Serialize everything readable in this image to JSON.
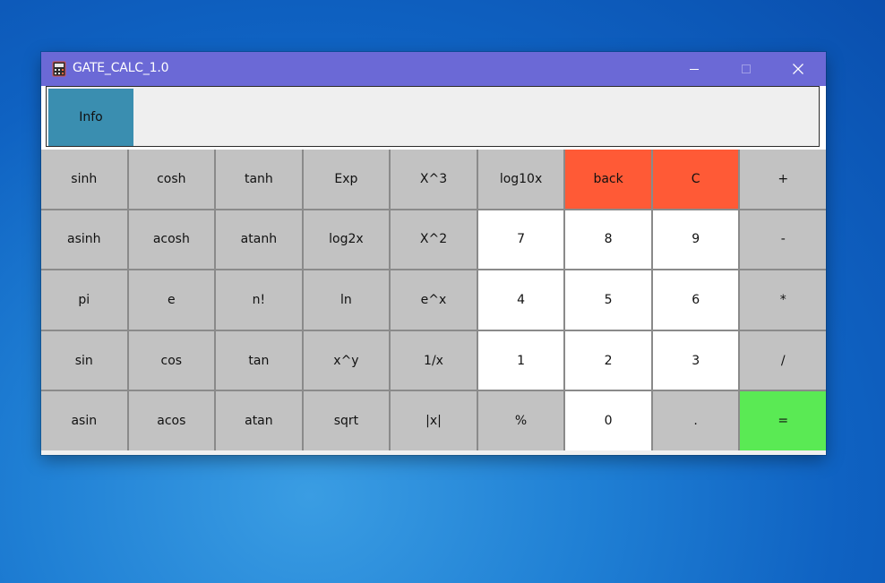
{
  "window": {
    "title": "GATE_CALC_1.0",
    "icon": "calculator-icon",
    "controls": [
      "minimize-icon",
      "maximize-icon",
      "close-icon"
    ]
  },
  "info_button": {
    "label": "Info"
  },
  "display": {
    "value": ""
  },
  "colors": {
    "titlebar": "#6b69d6",
    "info": "#3a8eb0",
    "function_key": "#c2c2c2",
    "digit_key": "#ffffff",
    "clear_key": "#ff5a36",
    "equals_key": "#5aea54"
  },
  "keys": [
    {
      "label": "sinh"
    },
    {
      "label": "cosh"
    },
    {
      "label": "tanh"
    },
    {
      "label": "Exp"
    },
    {
      "label": "X^3"
    },
    {
      "label": "log10x"
    },
    {
      "label": "back"
    },
    {
      "label": "C"
    },
    {
      "label": "+"
    },
    {
      "label": "asinh"
    },
    {
      "label": "acosh"
    },
    {
      "label": "atanh"
    },
    {
      "label": "log2x"
    },
    {
      "label": "X^2"
    },
    {
      "label": "7"
    },
    {
      "label": "8"
    },
    {
      "label": "9"
    },
    {
      "label": "-"
    },
    {
      "label": "pi"
    },
    {
      "label": "e"
    },
    {
      "label": "n!"
    },
    {
      "label": "ln"
    },
    {
      "label": "e^x"
    },
    {
      "label": "4"
    },
    {
      "label": "5"
    },
    {
      "label": "6"
    },
    {
      "label": "*"
    },
    {
      "label": "sin"
    },
    {
      "label": "cos"
    },
    {
      "label": "tan"
    },
    {
      "label": "x^y"
    },
    {
      "label": "1/x"
    },
    {
      "label": "1"
    },
    {
      "label": "2"
    },
    {
      "label": "3"
    },
    {
      "label": "/"
    },
    {
      "label": "asin"
    },
    {
      "label": "acos"
    },
    {
      "label": "atan"
    },
    {
      "label": "sqrt"
    },
    {
      "label": "|x|"
    },
    {
      "label": "%"
    },
    {
      "label": "0"
    },
    {
      "label": "."
    },
    {
      "label": "="
    }
  ]
}
